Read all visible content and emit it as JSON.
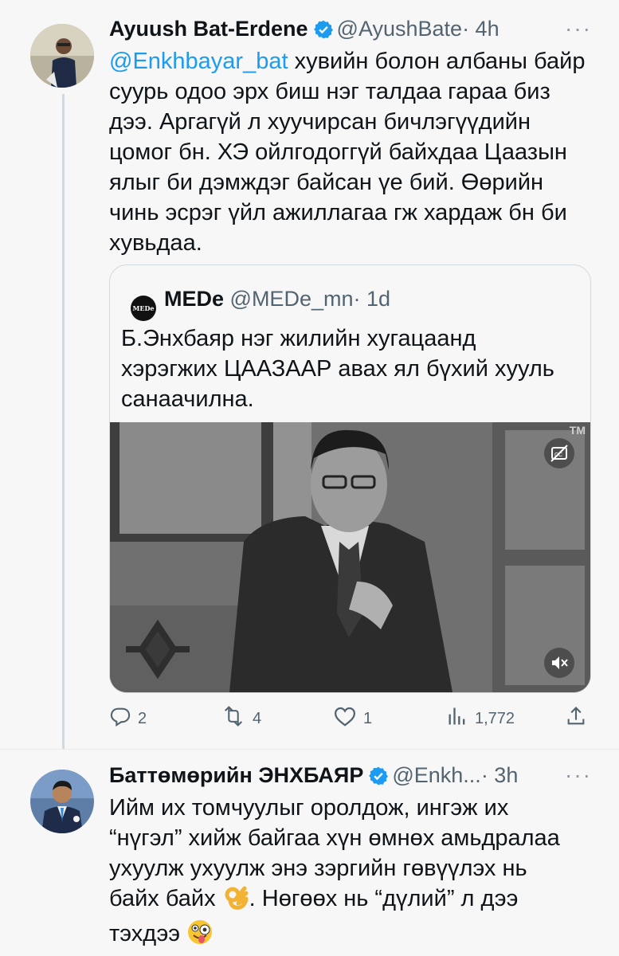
{
  "tweet1": {
    "name": "Ayuush Bat-Erdene",
    "handle": "@AyushBate",
    "time": "· 4h",
    "mention": "@Enkhbayar_bat",
    "text_after_mention": " хувийн болон албаны байр",
    "lines": [
      "суурь одоо эрх биш нэг талдаа гараа биз",
      "дээ. Аргагүй л хуучирсан бичлэгүүдийн",
      "цомог бн. ХЭ ойлгодоггүй байхдаа Цаазын",
      "ялыг би дэмждэг байсан үе бий. Өөрийн",
      "чинь эсрэг үйл ажиллагаа гж хардаж бн би",
      "хувьдаа."
    ],
    "quote": {
      "logo_text": "MEDe",
      "name": "MEDe",
      "handle": "@MEDe_mn",
      "time": "· 1d",
      "lines": [
        "Б.Энхбаяр нэг жилийн хугацаанд",
        "хэрэгжих ЦААЗААР авах ял бүхий хууль",
        "санаачилна."
      ],
      "video_watermark": "TM"
    },
    "actions": {
      "replies": "2",
      "retweets": "4",
      "likes": "1",
      "views": "1,772"
    }
  },
  "tweet2": {
    "name": "Баттөмөрийн ЭНХБАЯР",
    "handle": "@Enkh...",
    "time": "· 3h",
    "lines": [
      "Ийм их томчуулыг оролдож, ингэж их",
      "“нүгэл” хийж байгаа хүн өмнөх амьдралаа",
      "ухуулж ухуулж энэ зэргийн гөвүүлэх нь"
    ],
    "line4_before_emoji": "байх байх ",
    "line4_after_emoji": ". Нөгөөх нь “дүлий” л дээ",
    "line5": "тэхдээ"
  },
  "icons": {
    "verified": "verified-badge-icon",
    "more": "more-icon",
    "reply": "reply-icon",
    "retweet": "retweet-icon",
    "like": "like-icon",
    "views": "views-icon",
    "share": "share-icon",
    "captions": "captions-icon",
    "mute": "mute-icon"
  },
  "colors": {
    "accent": "#1d9bf0",
    "secondary_text": "#536471",
    "background": "#f7f7f7"
  }
}
